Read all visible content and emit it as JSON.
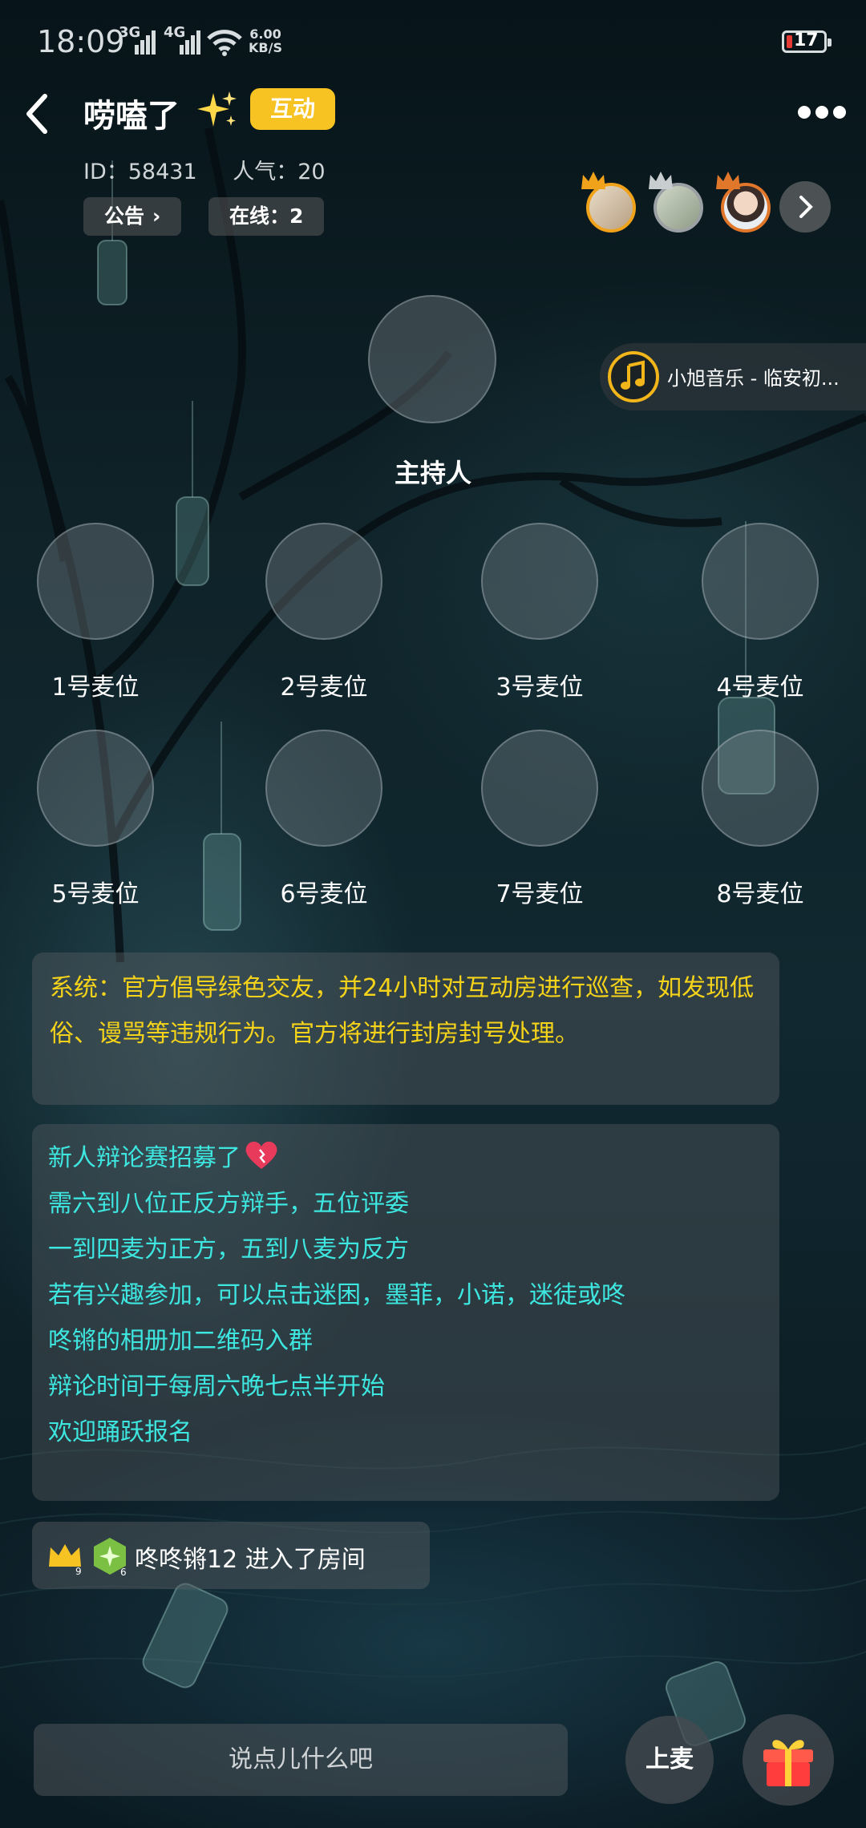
{
  "status_bar": {
    "time": "18:09",
    "signal_1": "3G",
    "signal_2": "4G",
    "speed_value": "6.00",
    "speed_unit": "KB/S",
    "battery": "17"
  },
  "header": {
    "room_name": "唠嗑了",
    "tag": "互动",
    "id_label": "ID：58431",
    "popularity_label": "人气：20",
    "announcement_label": "公告",
    "online_label": "在线：2"
  },
  "top_users": [
    {
      "icon": "avatar-girl-1",
      "crown_color": "#f0a21a"
    },
    {
      "icon": "avatar-girl-2",
      "crown_color": "#9aa0a4"
    },
    {
      "icon": "avatar-boy",
      "crown_color": "#e0772a"
    }
  ],
  "host": {
    "label": "主持人"
  },
  "music": {
    "text": "小旭音乐 - 临安初..."
  },
  "seats": [
    {
      "label": "1号麦位"
    },
    {
      "label": "2号麦位"
    },
    {
      "label": "3号麦位"
    },
    {
      "label": "4号麦位"
    },
    {
      "label": "5号麦位"
    },
    {
      "label": "6号麦位"
    },
    {
      "label": "7号麦位"
    },
    {
      "label": "8号麦位"
    }
  ],
  "system_message": "系统：官方倡导绿色交友，并24小时对互动房进行巡查，如发现低俗、谩骂等违规行为。官方将进行封房封号处理。",
  "notice_lines": [
    "新人辩论赛招募了",
    "需六到八位正反方辩手，五位评委",
    "一到四麦为正方，五到八麦为反方",
    "若有兴趣参加，可以点击迷困，墨菲，小诺，迷徒或咚",
    "咚锵的相册加二维码入群",
    "辩论时间于每周六晚七点半开始",
    "欢迎踊跃报名"
  ],
  "enter_message": {
    "badge_1": "9",
    "badge_2": "6",
    "text": "咚咚锵12 进入了房间"
  },
  "bottom": {
    "input_placeholder": "说点儿什么吧",
    "mic_label": "上麦",
    "gift_icon": "gift-icon"
  },
  "colors": {
    "accent_yellow": "#f6c323",
    "system_text": "#f5d31a",
    "notice_text": "#3ee6e0"
  }
}
